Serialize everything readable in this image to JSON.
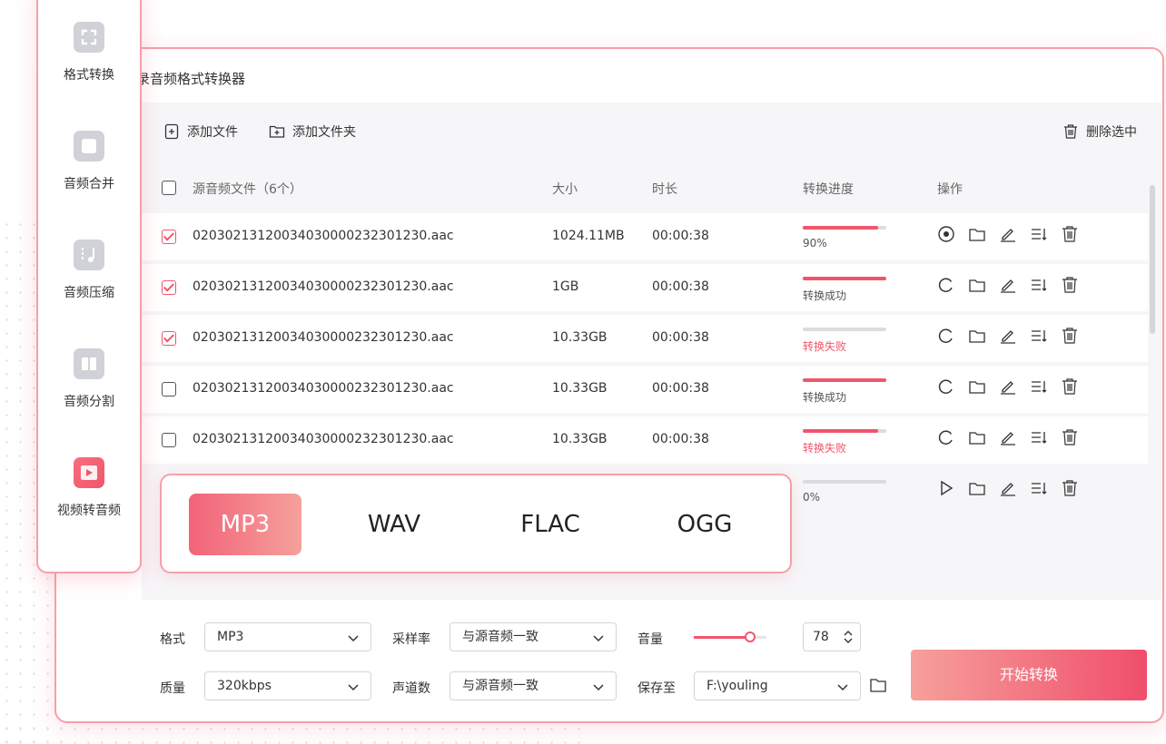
{
  "app_title": "录音频格式转换器",
  "toolbar": {
    "add_file": "添加文件",
    "add_folder": "添加文件夹",
    "delete_selected": "删除选中"
  },
  "table": {
    "headers": {
      "file": "源音频文件（6个）",
      "size": "大小",
      "duration": "时长",
      "progress": "转换进度",
      "actions": "操作"
    },
    "rows": [
      {
        "checked": true,
        "name": "02030213120034030000232301230.aac",
        "size": "1024.11MB",
        "duration": "00:00:38",
        "progress_pct": 90,
        "status": "90%",
        "status_type": "progress",
        "primary_op": "stop-icon"
      },
      {
        "checked": true,
        "name": "02030213120034030000232301230.aac",
        "size": "1GB",
        "duration": "00:00:38",
        "progress_pct": 100,
        "status": "转换成功",
        "status_type": "success",
        "primary_op": "refresh-icon"
      },
      {
        "checked": true,
        "name": "02030213120034030000232301230.aac",
        "size": "10.33GB",
        "duration": "00:00:38",
        "progress_pct": 0,
        "status": "转换失败",
        "status_type": "fail",
        "primary_op": "refresh-icon"
      },
      {
        "checked": false,
        "name": "02030213120034030000232301230.aac",
        "size": "10.33GB",
        "duration": "00:00:38",
        "progress_pct": 100,
        "status": "转换成功",
        "status_type": "success",
        "primary_op": "refresh-icon"
      },
      {
        "checked": false,
        "name": "02030213120034030000232301230.aac",
        "size": "10.33GB",
        "duration": "00:00:38",
        "progress_pct": 90,
        "status": "转换失败",
        "status_type": "fail",
        "primary_op": "refresh-icon"
      },
      {
        "checked": false,
        "name": "",
        "size": "",
        "duration": "",
        "progress_pct": 0,
        "status": "0%",
        "status_type": "progress",
        "primary_op": "play-icon"
      }
    ]
  },
  "sidebar": {
    "items": [
      {
        "label": "格式转换",
        "icon": "format-convert-icon",
        "active": false
      },
      {
        "label": "音频合并",
        "icon": "audio-merge-icon",
        "active": false
      },
      {
        "label": "音频压缩",
        "icon": "audio-compress-icon",
        "active": false
      },
      {
        "label": "音频分割",
        "icon": "audio-split-icon",
        "active": false
      },
      {
        "label": "视频转音频",
        "icon": "video-to-audio-icon",
        "active": true
      }
    ]
  },
  "formats": {
    "options": [
      "MP3",
      "WAV",
      "FLAC",
      "OGG"
    ],
    "selected": "MP3"
  },
  "settings": {
    "format_label": "格式",
    "format_value": "MP3",
    "quality_label": "质量",
    "quality_value": "320kbps",
    "sample_rate_label": "采样率",
    "sample_rate_value": "与源音频一致",
    "channels_label": "声道数",
    "channels_value": "与源音频一致",
    "volume_label": "音量",
    "volume_value": "78",
    "save_to_label": "保存至",
    "save_to_value": "F:\\youling"
  },
  "start_button": "开始转换",
  "colors": {
    "accent": "#f0566b",
    "border": "#f5a0a8",
    "panel_bg": "#f6f6f8"
  }
}
